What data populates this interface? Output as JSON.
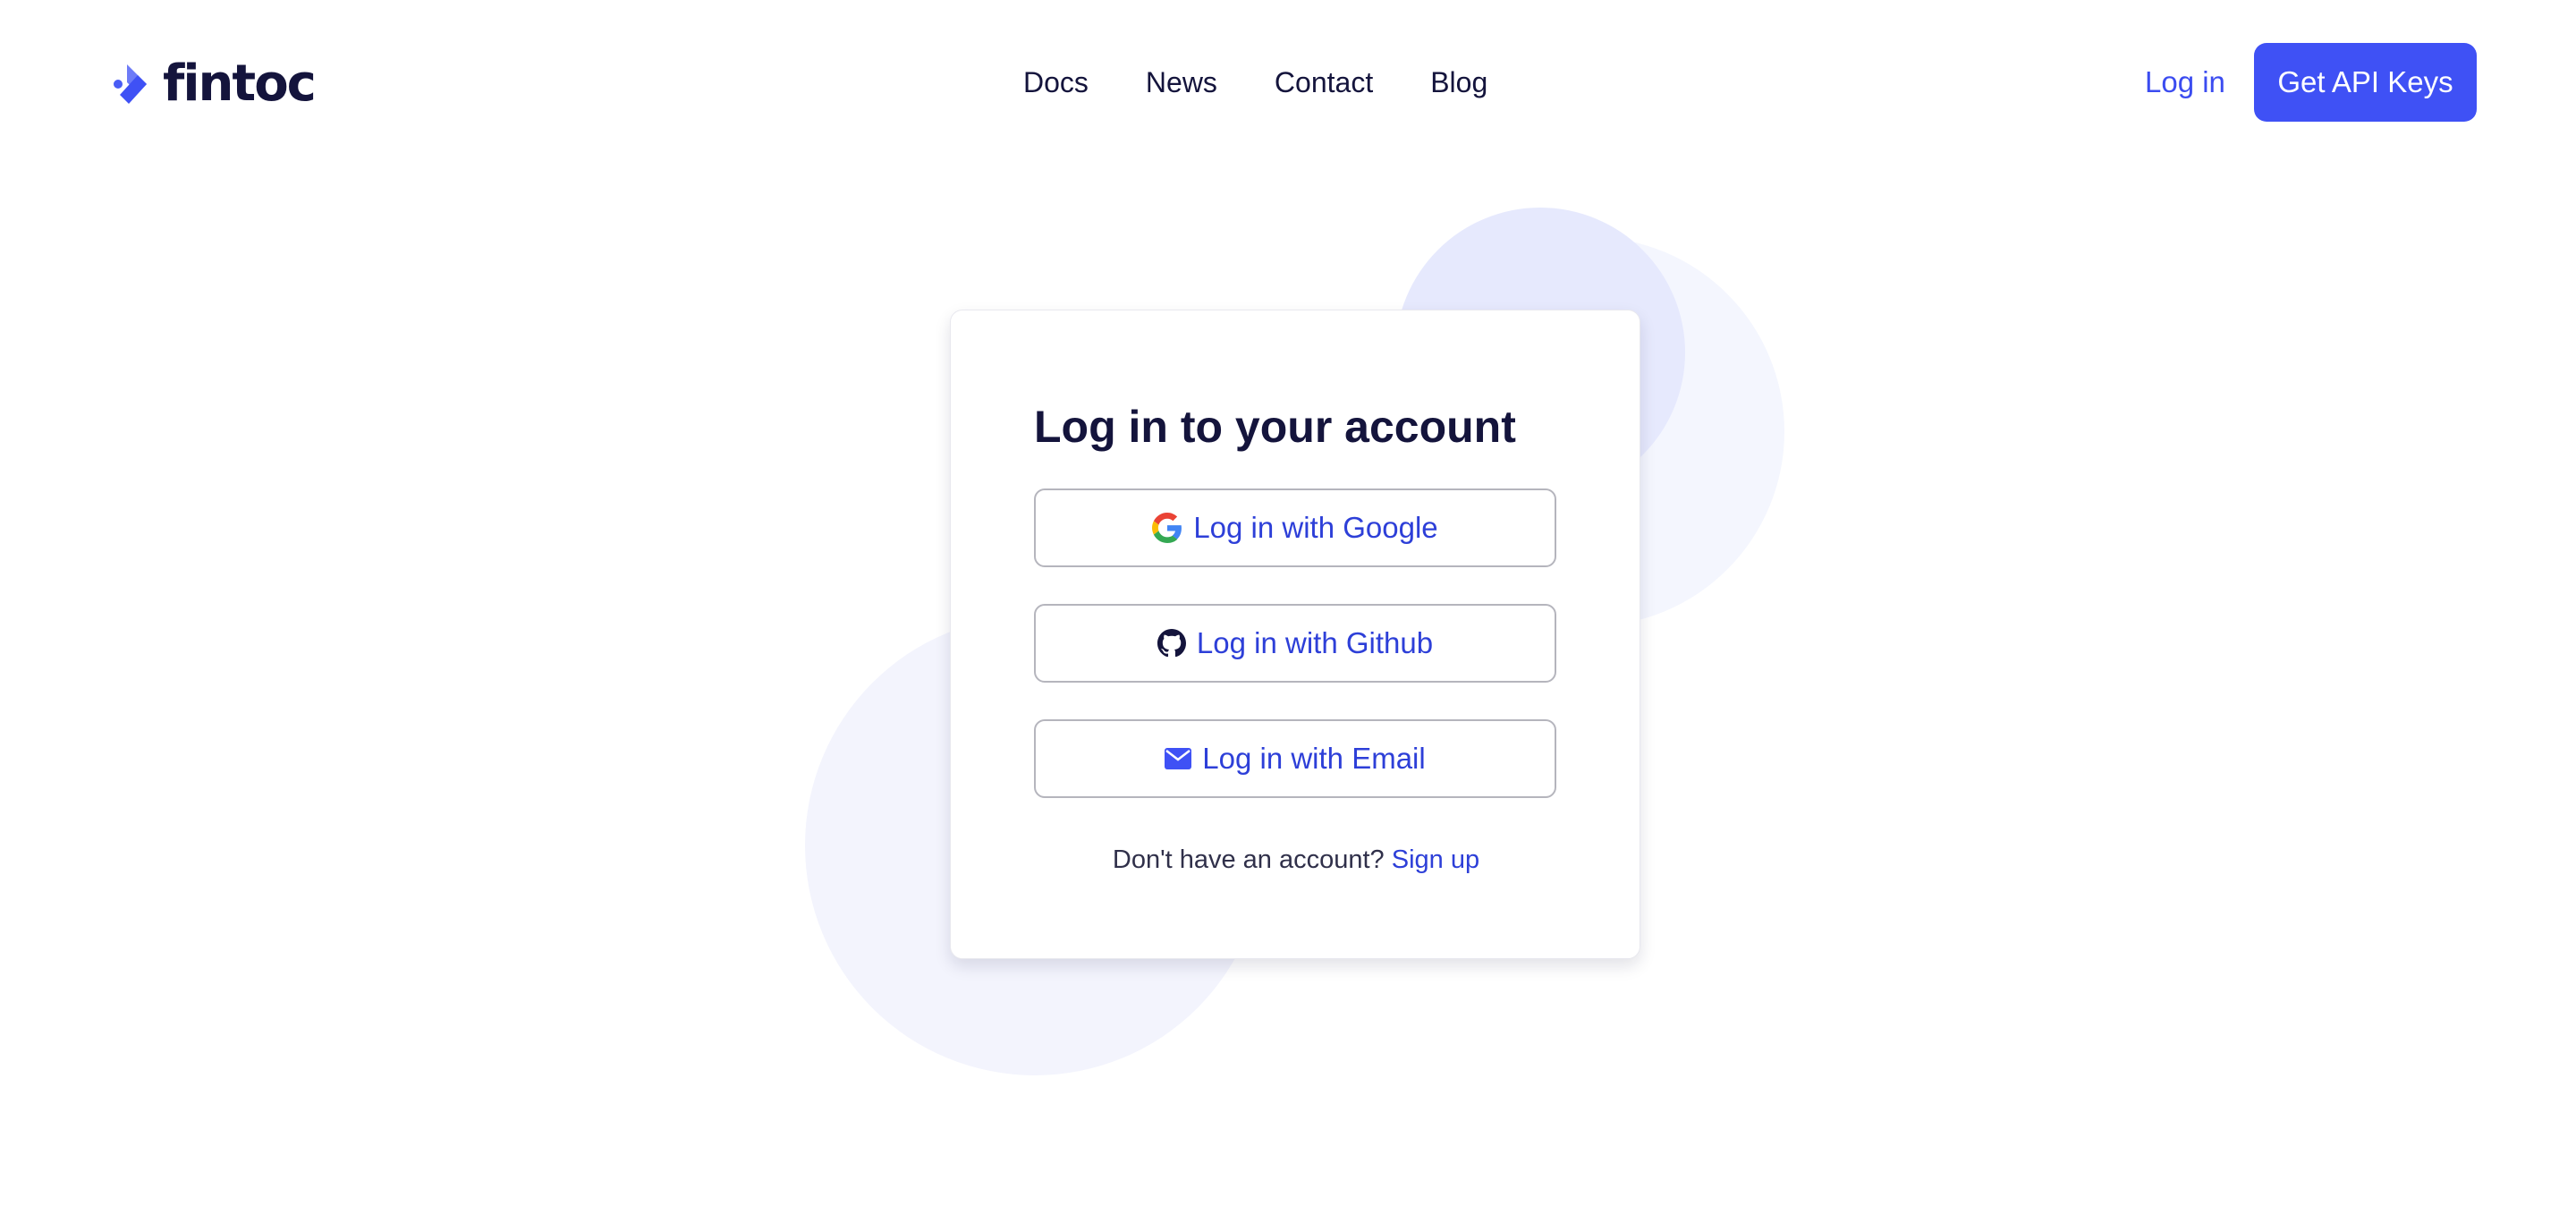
{
  "header": {
    "logo_text": "fintoc",
    "nav": [
      "Docs",
      "News",
      "Contact",
      "Blog"
    ],
    "login_label": "Log in",
    "cta_label": "Get API Keys"
  },
  "card": {
    "title": "Log in to your account",
    "buttons": [
      {
        "label": "Log in with Google",
        "icon": "google-icon"
      },
      {
        "label": "Log in with Github",
        "icon": "github-icon"
      },
      {
        "label": "Log in with Email",
        "icon": "mail-icon"
      }
    ],
    "signup_prompt": "Don't have an account?",
    "signup_label": "Sign up"
  },
  "colors": {
    "accent": "#3f51f5",
    "link": "#2d3fd8",
    "text": "#14143c"
  }
}
